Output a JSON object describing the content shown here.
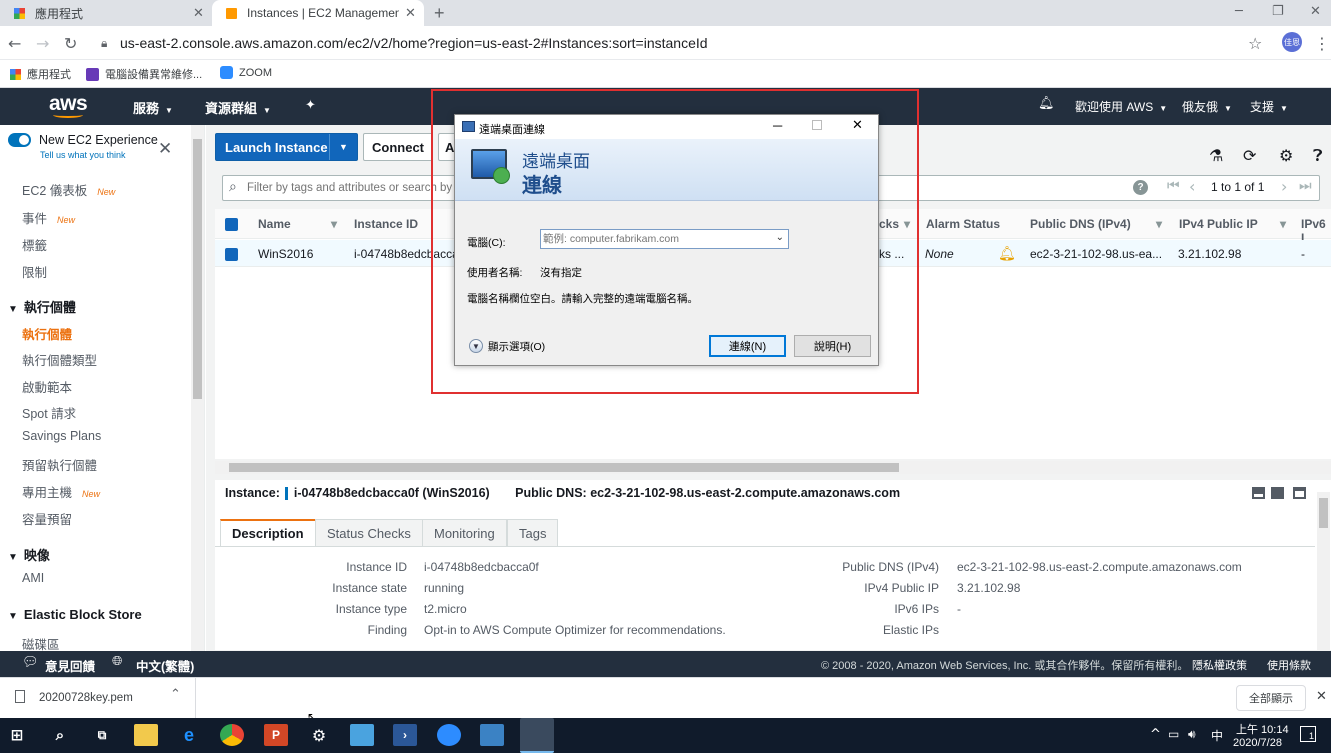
{
  "browser": {
    "tabs": [
      {
        "label": "應用程式"
      },
      {
        "label": "Instances | EC2 Management C"
      }
    ],
    "url": "us-east-2.console.aws.amazon.com/ec2/v2/home?region=us-east-2#Instances:sort=instanceId",
    "profile": "佳恩",
    "bookmarks": [
      "應用程式",
      "電腦設備異常維修...",
      "ZOOM"
    ]
  },
  "aws_header": {
    "logo": "aws",
    "services": "服務",
    "resource_groups": "資源群組",
    "account": "歡迎使用 AWS",
    "user": "俄友俄",
    "support": "支援"
  },
  "sidebar": {
    "experience_title": "New EC2 Experience",
    "experience_sub": "Tell us what you think",
    "new_badge": "New",
    "items": [
      {
        "label": "EC2 儀表板",
        "new": true
      },
      {
        "label": "事件",
        "new": true
      },
      {
        "label": "標籤"
      },
      {
        "label": "限制"
      }
    ],
    "section_instances": "執行個體",
    "instances_items": [
      {
        "label": "執行個體"
      },
      {
        "label": "執行個體類型"
      },
      {
        "label": "啟動範本"
      },
      {
        "label": "Spot 請求"
      },
      {
        "label": "Savings Plans"
      },
      {
        "label": "預留執行個體"
      },
      {
        "label": "專用主機",
        "new": true
      },
      {
        "label": "容量預留"
      }
    ],
    "section_images": "映像",
    "images_items": [
      {
        "label": "AMI"
      }
    ],
    "section_ebs": "Elastic Block Store",
    "ebs_items": [
      {
        "label": "磁碟區"
      }
    ]
  },
  "toolbar": {
    "launch": "Launch Instance",
    "connect": "Connect",
    "actions_partial": "A"
  },
  "filter": {
    "placeholder": "Filter by tags and attributes or search by",
    "pagination": "1 to 1 of 1"
  },
  "table": {
    "headers": [
      "Name",
      "Instance ID",
      "cks",
      "Alarm Status",
      "Public DNS (IPv4)",
      "IPv4 Public IP",
      "IPv6 I"
    ],
    "row": {
      "name": "WinS2016",
      "instance_id": "i-04748b8edcbacca",
      "checks": "ks ...",
      "alarm": "None",
      "dns": "ec2-3-21-102-98.us-ea...",
      "ip": "3.21.102.98",
      "ipv6": "-"
    }
  },
  "details": {
    "instance_label": "Instance:",
    "instance_value": "i-04748b8edcbacca0f (WinS2016)",
    "dns_label": "Public DNS:",
    "dns_value": "ec2-3-21-102-98.us-east-2.compute.amazonaws.com",
    "tabs": [
      "Description",
      "Status Checks",
      "Monitoring",
      "Tags"
    ],
    "left": [
      {
        "label": "Instance ID",
        "value": "i-04748b8edcbacca0f"
      },
      {
        "label": "Instance state",
        "value": "running"
      },
      {
        "label": "Instance type",
        "value": "t2.micro"
      },
      {
        "label": "Finding",
        "value": "Opt-in to AWS Compute Optimizer for recommendations."
      }
    ],
    "right": [
      {
        "label": "Public DNS (IPv4)",
        "value": "ec2-3-21-102-98.us-east-2.compute.amazonaws.com"
      },
      {
        "label": "IPv4 Public IP",
        "value": "3.21.102.98"
      },
      {
        "label": "IPv6 IPs",
        "value": "-"
      },
      {
        "label": "Elastic IPs",
        "value": ""
      }
    ]
  },
  "footer": {
    "feedback": "意見回饋",
    "language": "中文(繁體)",
    "copyright": "© 2008 - 2020, Amazon Web Services, Inc. 或其合作夥伴。保留所有權利。",
    "privacy": "隱私權政策",
    "terms": "使用條款"
  },
  "download": {
    "file": "20200728key.pem",
    "show_all": "全部顯示"
  },
  "taskbar": {
    "time": "上午 10:14",
    "date": "2020/7/28",
    "ime": "中",
    "notifications": "1"
  },
  "rdp_dialog": {
    "title": "遠端桌面連線",
    "header_line1": "遠端桌面",
    "header_line2": "連線",
    "computer_label": "電腦(C):",
    "computer_placeholder": "範例: computer.fabrikam.com",
    "username_label": "使用者名稱:",
    "username_value": "沒有指定",
    "message": "電腦名稱欄位空白。請輸入完整的遠端電腦名稱。",
    "show_options": "顯示選項(O)",
    "connect": "連線(N)",
    "help": "說明(H)"
  }
}
